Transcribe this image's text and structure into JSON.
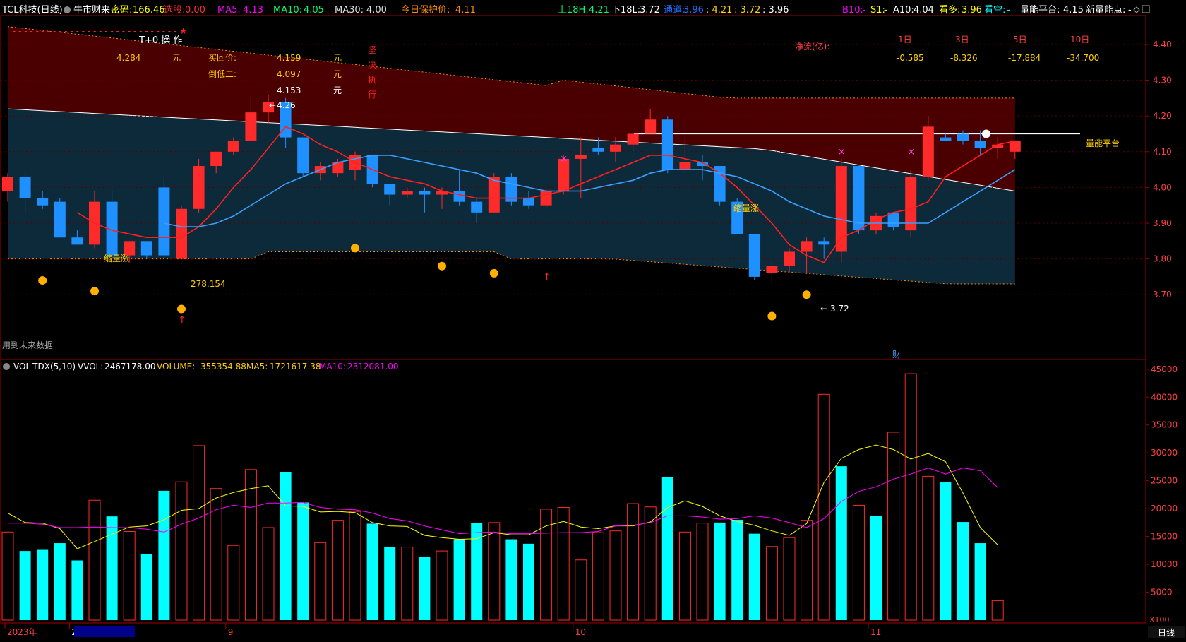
{
  "header": {
    "title": "TCL科技(日线)",
    "source_label": "牛市财来",
    "password": {
      "label": "密码:",
      "value": "166.46"
    },
    "limit_down": {
      "label": "选股:",
      "value": "0.00"
    },
    "ma5": {
      "label": "MA5:",
      "value": "4.13"
    },
    "ma10": {
      "label": "MA10:",
      "value": "4.05"
    },
    "ma30": {
      "label": "MA30:",
      "value": "4.00"
    },
    "protect": {
      "label": "今日保护价:",
      "value": "4.11"
    },
    "up18h": {
      "label": "上18H:",
      "value": "4.21"
    },
    "down18l": {
      "label": "下18L:",
      "value": "3.72"
    },
    "channel": {
      "label": "通道:",
      "value": "3.96"
    },
    "range": {
      "value1": ": 4.21",
      "value2": ": 3.72",
      "value3": ": 3.96"
    },
    "b10": {
      "label": "B10:",
      "value": "-"
    },
    "s1": {
      "label": "S1:",
      "value": "-"
    },
    "a10": {
      "label": "A10:",
      "value": "4.04"
    },
    "bull": {
      "label": "看多:",
      "value": "3.96"
    },
    "bear": {
      "label": "看空:",
      "value": "-"
    },
    "platform": {
      "label": "量能平台:",
      "value": "4.15"
    },
    "new_point": {
      "label": "新量能点:",
      "value": "-"
    }
  },
  "t0_panel": {
    "title": "T+0 操 作",
    "rows": [
      {
        "val1": "4.284",
        "unit1": "元",
        "label": "买回价:",
        "val2": "4.159",
        "unit2": "元"
      },
      {
        "val1": "",
        "unit1": "",
        "label": "倒低二:",
        "val2": "4.097",
        "unit2": "元"
      },
      {
        "val1": "",
        "unit1": "",
        "label": "",
        "val2": "4.153",
        "unit2": "元"
      }
    ],
    "vertical_text": [
      "坚",
      "决",
      "执",
      "行"
    ]
  },
  "netflow": {
    "label": "净流(亿):",
    "periods": [
      "1日",
      "3日",
      "5日",
      "10日"
    ],
    "values": [
      "-0.585",
      "-8.326",
      "-17.884",
      "-34.700"
    ]
  },
  "annotations": {
    "high_label": "4.26",
    "low_label": "3.72",
    "shrink_rise": "缩量涨",
    "volume_label": "278.154",
    "platform_label": "量能平台",
    "future_data": "用到未来数据",
    "finance_marker": "财"
  },
  "volume_header": {
    "indicator": "VOL-TDX(5,10)",
    "vvol": {
      "label": "VVOL:",
      "value": "2467178.00"
    },
    "volume": {
      "label": "VOLUME:",
      "value": "355354.88"
    },
    "ma5": {
      "label": "MA5:",
      "value": "1721617.38"
    },
    "ma10": {
      "label": "MA10:",
      "value": "2312081.00"
    }
  },
  "xaxis": {
    "labels": [
      {
        "text": "2023年",
        "index": 0
      },
      {
        "text": "2023/08/21/一",
        "index": 4
      },
      {
        "text": "9",
        "index": 13
      },
      {
        "text": "10",
        "index": 33
      },
      {
        "text": "11",
        "index": 50
      }
    ],
    "period_button": "日线",
    "unit_label": "X100"
  },
  "colors": {
    "up": "#ff2a2a",
    "down": "#1e90ff",
    "vol_down": "#00ffff",
    "ma5": "#ffff00",
    "ma10": "#ff00ff",
    "band_upper": "#4a0000",
    "band_lower": "#0d2a3a"
  },
  "chart_data": [
    {
      "type": "candlestick",
      "title": "TCL科技(日线)",
      "ylim": [
        3.6,
        4.5
      ],
      "yticks": [
        "4.40",
        "4.30",
        "4.20",
        "4.10",
        "4.00",
        "3.90",
        "3.80",
        "3.70"
      ],
      "candles": [
        {
          "o": 3.99,
          "h": 4.04,
          "l": 3.96,
          "c": 4.03
        },
        {
          "o": 4.03,
          "h": 4.04,
          "l": 3.93,
          "c": 3.97
        },
        {
          "o": 3.97,
          "h": 3.99,
          "l": 3.94,
          "c": 3.95
        },
        {
          "o": 3.96,
          "h": 3.97,
          "l": 3.87,
          "c": 3.86
        },
        {
          "o": 3.86,
          "h": 3.88,
          "l": 3.84,
          "c": 3.84
        },
        {
          "o": 3.84,
          "h": 3.99,
          "l": 3.83,
          "c": 3.96
        },
        {
          "o": 3.96,
          "h": 3.99,
          "l": 3.8,
          "c": 3.81
        },
        {
          "o": 3.81,
          "h": 3.85,
          "l": 3.79,
          "c": 3.85
        },
        {
          "o": 3.85,
          "h": 3.85,
          "l": 3.8,
          "c": 3.81
        },
        {
          "o": 4.0,
          "h": 4.03,
          "l": 3.8,
          "c": 3.81
        },
        {
          "o": 3.8,
          "h": 3.95,
          "l": 3.8,
          "c": 3.94
        },
        {
          "o": 3.94,
          "h": 4.08,
          "l": 3.93,
          "c": 4.06
        },
        {
          "o": 4.06,
          "h": 4.1,
          "l": 4.04,
          "c": 4.1
        },
        {
          "o": 4.1,
          "h": 4.14,
          "l": 4.09,
          "c": 4.13
        },
        {
          "o": 4.13,
          "h": 4.26,
          "l": 4.13,
          "c": 4.21
        },
        {
          "o": 4.21,
          "h": 4.26,
          "l": 4.18,
          "c": 4.24
        },
        {
          "o": 4.24,
          "h": 4.25,
          "l": 4.11,
          "c": 4.14
        },
        {
          "o": 4.14,
          "h": 4.14,
          "l": 4.03,
          "c": 4.04
        },
        {
          "o": 4.04,
          "h": 4.07,
          "l": 4.02,
          "c": 4.06
        },
        {
          "o": 4.04,
          "h": 4.08,
          "l": 4.03,
          "c": 4.07
        },
        {
          "o": 4.05,
          "h": 4.1,
          "l": 4.02,
          "c": 4.09
        },
        {
          "o": 4.09,
          "h": 4.09,
          "l": 4.0,
          "c": 4.01
        },
        {
          "o": 4.01,
          "h": 4.01,
          "l": 3.95,
          "c": 3.98
        },
        {
          "o": 3.98,
          "h": 4.0,
          "l": 3.97,
          "c": 3.99
        },
        {
          "o": 3.99,
          "h": 4.0,
          "l": 3.93,
          "c": 3.98
        },
        {
          "o": 3.98,
          "h": 4.0,
          "l": 3.94,
          "c": 3.99
        },
        {
          "o": 3.99,
          "h": 4.05,
          "l": 3.95,
          "c": 3.96
        },
        {
          "o": 3.96,
          "h": 3.97,
          "l": 3.9,
          "c": 3.93
        },
        {
          "o": 3.93,
          "h": 4.04,
          "l": 3.93,
          "c": 4.03
        },
        {
          "o": 4.03,
          "h": 4.04,
          "l": 3.95,
          "c": 3.96
        },
        {
          "o": 3.97,
          "h": 3.99,
          "l": 3.94,
          "c": 3.95
        },
        {
          "o": 3.95,
          "h": 4.0,
          "l": 3.94,
          "c": 3.99
        },
        {
          "o": 3.99,
          "h": 4.09,
          "l": 3.98,
          "c": 4.08
        },
        {
          "o": 4.08,
          "h": 4.14,
          "l": 3.97,
          "c": 4.09
        },
        {
          "o": 4.11,
          "h": 4.14,
          "l": 4.09,
          "c": 4.1
        },
        {
          "o": 4.1,
          "h": 4.14,
          "l": 4.07,
          "c": 4.12
        },
        {
          "o": 4.12,
          "h": 4.15,
          "l": 4.1,
          "c": 4.15
        },
        {
          "o": 4.15,
          "h": 4.22,
          "l": 4.15,
          "c": 4.19
        },
        {
          "o": 4.19,
          "h": 4.2,
          "l": 4.04,
          "c": 4.05
        },
        {
          "o": 4.05,
          "h": 4.14,
          "l": 4.04,
          "c": 4.07
        },
        {
          "o": 4.07,
          "h": 4.09,
          "l": 4.02,
          "c": 4.06
        },
        {
          "o": 4.06,
          "h": 4.06,
          "l": 3.95,
          "c": 3.96
        },
        {
          "o": 3.96,
          "h": 3.97,
          "l": 3.87,
          "c": 3.87
        },
        {
          "o": 3.87,
          "h": 3.87,
          "l": 3.74,
          "c": 3.75
        },
        {
          "o": 3.76,
          "h": 3.79,
          "l": 3.73,
          "c": 3.78
        },
        {
          "o": 3.78,
          "h": 3.83,
          "l": 3.76,
          "c": 3.82
        },
        {
          "o": 3.82,
          "h": 3.86,
          "l": 3.76,
          "c": 3.85
        },
        {
          "o": 3.85,
          "h": 3.86,
          "l": 3.8,
          "c": 3.84
        },
        {
          "o": 3.82,
          "h": 4.08,
          "l": 3.79,
          "c": 4.06
        },
        {
          "o": 4.06,
          "h": 4.06,
          "l": 3.87,
          "c": 3.88
        },
        {
          "o": 3.88,
          "h": 3.93,
          "l": 3.87,
          "c": 3.92
        },
        {
          "o": 3.93,
          "h": 3.93,
          "l": 3.88,
          "c": 3.89
        },
        {
          "o": 3.88,
          "h": 4.05,
          "l": 3.86,
          "c": 4.03
        },
        {
          "o": 4.03,
          "h": 4.2,
          "l": 4.02,
          "c": 4.17
        },
        {
          "o": 4.14,
          "h": 4.15,
          "l": 4.13,
          "c": 4.13
        },
        {
          "o": 4.15,
          "h": 4.16,
          "l": 4.12,
          "c": 4.13
        },
        {
          "o": 4.13,
          "h": 4.16,
          "l": 4.09,
          "c": 4.11
        },
        {
          "o": 4.11,
          "h": 4.14,
          "l": 4.08,
          "c": 4.12
        },
        {
          "o": 4.1,
          "h": 4.13,
          "l": 4.08,
          "c": 4.13
        }
      ],
      "series": [
        {
          "name": "MA5",
          "values": [
            null,
            null,
            null,
            null,
            3.93,
            3.9,
            3.88,
            3.87,
            3.86,
            3.86,
            3.86,
            3.89,
            3.94,
            4.0,
            4.05,
            4.11,
            4.17,
            4.15,
            4.12,
            4.1,
            4.07,
            4.05,
            4.03,
            4.02,
            4.01,
            3.99,
            3.98,
            3.97,
            3.97,
            3.97,
            3.97,
            3.98,
            3.99,
            4.01,
            4.03,
            4.05,
            4.07,
            4.09,
            4.09,
            4.08,
            4.07,
            4.04,
            4.0,
            3.95,
            3.9,
            3.84,
            3.81,
            3.79,
            3.86,
            3.88,
            3.91,
            3.93,
            3.94,
            3.96,
            4.03,
            4.06,
            4.09,
            4.12,
            4.13
          ]
        },
        {
          "name": "MA10",
          "values": [
            null,
            null,
            null,
            null,
            null,
            null,
            null,
            null,
            null,
            3.9,
            3.89,
            3.89,
            3.9,
            3.92,
            3.95,
            3.98,
            4.01,
            4.03,
            4.05,
            4.07,
            4.08,
            4.09,
            4.09,
            4.08,
            4.07,
            4.06,
            4.05,
            4.04,
            4.02,
            4.01,
            4.0,
            3.99,
            3.99,
            3.99,
            4.0,
            4.01,
            4.02,
            4.04,
            4.05,
            4.05,
            4.05,
            4.04,
            4.03,
            4.01,
            3.99,
            3.96,
            3.94,
            3.92,
            3.91,
            3.9,
            3.9,
            3.9,
            3.9,
            3.9,
            3.93,
            3.96,
            3.99,
            4.02,
            4.05
          ]
        }
      ]
    },
    {
      "type": "bar",
      "title": "VOL-TDX(5,10)",
      "ylim": [
        0,
        47000
      ],
      "yticks": [
        "45000",
        "40000",
        "35000",
        "30000",
        "25000",
        "20000",
        "15000",
        "10000",
        "5000"
      ],
      "values": [
        15800,
        12400,
        12600,
        13800,
        10700,
        21500,
        18600,
        15900,
        11900,
        23200,
        24800,
        31300,
        23600,
        13400,
        27000,
        16600,
        26500,
        21100,
        13900,
        17900,
        19500,
        17300,
        13100,
        13100,
        11400,
        12400,
        14500,
        17400,
        17500,
        14500,
        13700,
        19900,
        20200,
        10800,
        15700,
        16000,
        20900,
        20300,
        25700,
        15800,
        17400,
        17500,
        18000,
        15500,
        13200,
        14800,
        17900,
        40500,
        27600,
        20600,
        18700,
        33700,
        44200,
        25800,
        24700,
        17600,
        13800,
        3500
      ],
      "up": [
        1,
        0,
        0,
        0,
        0,
        1,
        0,
        1,
        0,
        0,
        1,
        1,
        1,
        1,
        1,
        1,
        0,
        0,
        1,
        1,
        1,
        0,
        0,
        1,
        0,
        1,
        0,
        0,
        1,
        0,
        0,
        1,
        1,
        1,
        1,
        1,
        1,
        1,
        0,
        1,
        1,
        0,
        0,
        0,
        1,
        1,
        1,
        1,
        0,
        1,
        0,
        1,
        1,
        1,
        0,
        0,
        0,
        1
      ],
      "series": [
        {
          "name": "MA5",
          "values": [
            19200,
            17500,
            17400,
            16400,
            12800,
            14100,
            15400,
            16700,
            16900,
            18000,
            19700,
            20000,
            21900,
            22900,
            23600,
            24100,
            20500,
            20400,
            19400,
            19500,
            19300,
            17500,
            16900,
            16800,
            15200,
            14800,
            14500,
            14600,
            15700,
            15300,
            15300,
            16900,
            17700,
            16700,
            16400,
            16900,
            16900,
            17600,
            20200,
            21400,
            20400,
            18700,
            17700,
            17000,
            16000,
            15200,
            17300,
            24700,
            29000,
            30600,
            31400,
            30600,
            28900,
            29900,
            28400,
            22800,
            16600,
            13500
          ]
        },
        {
          "name": "MA10",
          "values": [
            17400,
            17400,
            17200,
            16600,
            16600,
            16700,
            16600,
            16600,
            16300,
            15800,
            17200,
            18300,
            19800,
            20600,
            20200,
            21000,
            21000,
            21100,
            20200,
            19900,
            19800,
            19200,
            18200,
            17800,
            16900,
            16200,
            15500,
            15700,
            15800,
            15500,
            15500,
            15600,
            15700,
            15700,
            15900,
            16900,
            17000,
            17500,
            18700,
            18700,
            18500,
            18100,
            18200,
            18700,
            18300,
            17500,
            16600,
            18200,
            21300,
            23100,
            23900,
            25300,
            26200,
            27300,
            26200,
            27300,
            26800,
            23800
          ]
        }
      ]
    }
  ]
}
